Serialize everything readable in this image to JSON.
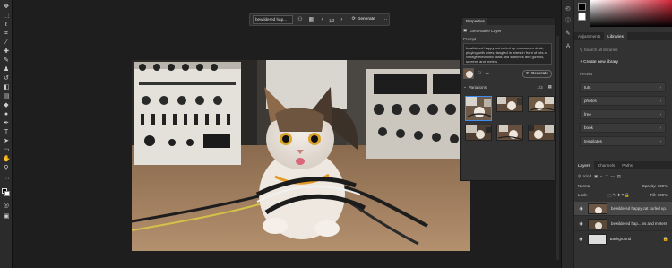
{
  "taskbar": {
    "prompt_text": "bewildered hap...",
    "variation_count": "1/3",
    "generate_label": "Generate",
    "more": "···"
  },
  "properties": {
    "tab": "Properties",
    "layer_type": "Generative Layer",
    "prompt_label": "Prompt",
    "prompt_text": "bewildered happy cat curled up on wooden desk, playing with wires, tangled in wires in front of lots of vintage electronic dials and switches and gizmos, screens and meters",
    "generate_label": "Generate",
    "variations_label": "Variations",
    "variations_count": "1/3"
  },
  "dock": {
    "tabs": [
      "Adjustments",
      "Libraries"
    ],
    "search_placeholder": "Search all libraries",
    "create_label": "+ Create new library",
    "recent_label": "Recent",
    "libraries": [
      "tuts",
      "photos",
      "free",
      "book",
      "templates"
    ],
    "layer_tabs": [
      "Layers",
      "Channels",
      "Paths"
    ],
    "filter_label": "Kind",
    "blend_mode": "Normal",
    "opacity_label": "Opacity:",
    "opacity_value": "100%",
    "lock_label": "Lock:",
    "fill_label": "Fill:",
    "fill_value": "100%",
    "layers": [
      {
        "name": "bewildered happy cat curled up..."
      },
      {
        "name": "bewildered hap....ns and meters"
      },
      {
        "name": "Background"
      }
    ]
  },
  "colors": {
    "accent": "#3b8ef0",
    "panel": "#323232",
    "background": "#1e1e1e"
  }
}
